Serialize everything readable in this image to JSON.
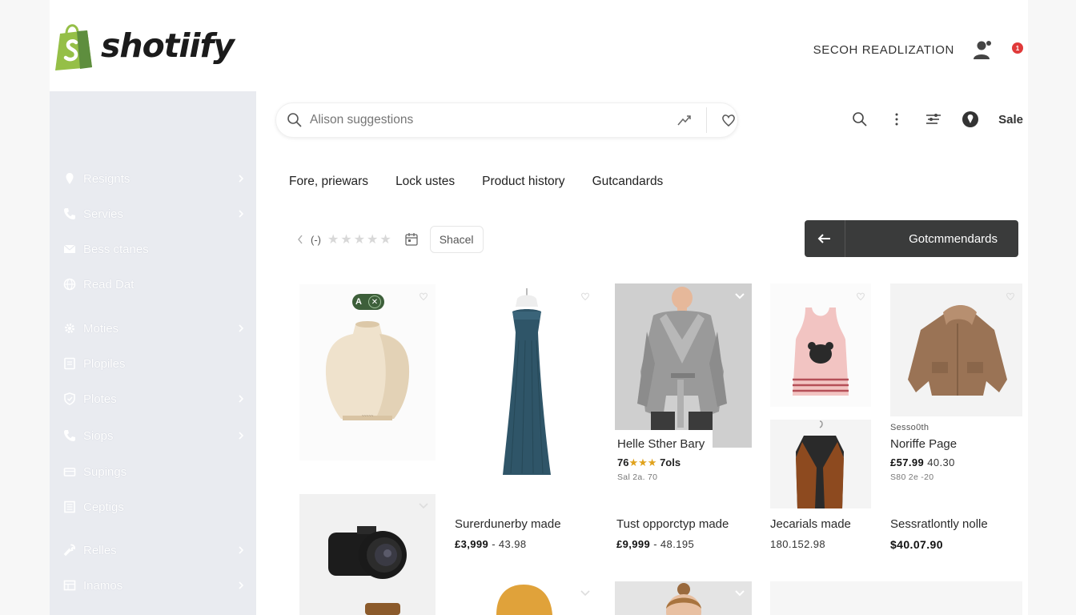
{
  "brand": {
    "name": "shotiify",
    "color": "#95bf47"
  },
  "header": {
    "link_label": "SECOH READLIZATION",
    "notification_count": "1"
  },
  "sidebar": {
    "items": [
      {
        "label": "Resignts",
        "icon": "pin-icon",
        "chevron": true
      },
      {
        "label": "Servies",
        "icon": "phone-icon",
        "chevron": true
      },
      {
        "label": "Bess ctanes",
        "icon": "mail-icon",
        "chevron": false
      },
      {
        "label": "Read Dat",
        "icon": "globe-icon",
        "chevron": false
      },
      {
        "label": "Moties",
        "icon": "gear-icon",
        "chevron": true
      },
      {
        "label": "Plopiles",
        "icon": "document-icon",
        "chevron": false
      },
      {
        "label": "Plotes",
        "icon": "shield-icon",
        "chevron": true
      },
      {
        "label": "Siops",
        "icon": "phone-icon",
        "chevron": true
      },
      {
        "label": "Supings",
        "icon": "box-icon",
        "chevron": false
      },
      {
        "label": "Ceptigs",
        "icon": "list-icon",
        "chevron": false
      },
      {
        "label": "Relles",
        "icon": "wrench-icon",
        "chevron": true
      },
      {
        "label": "Inamos",
        "icon": "table-icon",
        "chevron": true
      }
    ]
  },
  "search": {
    "placeholder": "Alison suggestions"
  },
  "toolbar": {
    "sale_label": "Sale"
  },
  "tabs": [
    {
      "label": "Fore, priewars"
    },
    {
      "label": "Lock ustes"
    },
    {
      "label": "Product history"
    },
    {
      "label": "Gutcandards"
    }
  ],
  "filters": {
    "paren_label": "(-)",
    "stars_total": 5,
    "button_label": "Shacel"
  },
  "cta": {
    "label": "Gotcmmendards"
  },
  "badge": {
    "left": "A",
    "right": "✕"
  },
  "products": [
    {
      "title": "Helle Sther Bary",
      "rating_prefix": "76",
      "rating_stars": "★★★",
      "rating_suffix": "7ols",
      "sub": "Sal 2a. 70"
    },
    {
      "tag": "Sesso0th",
      "title": "Noriffe Page",
      "price_main": "£57.99",
      "price_rest": "40.30",
      "sub": "S80 2e -20"
    },
    {
      "title": "Surerdunerby made",
      "price_main": "£3,999",
      "price_rest": "- 43.98"
    },
    {
      "title": "Tust opporctyp made",
      "price_main": "£9,999",
      "price_rest": "- 48.195"
    },
    {
      "title": "Jecarials made",
      "price_main": "",
      "price_rest": "180.152.98"
    },
    {
      "title": "Sessratlontly nolle",
      "price_main": "$40.07.90",
      "price_rest": ""
    }
  ]
}
